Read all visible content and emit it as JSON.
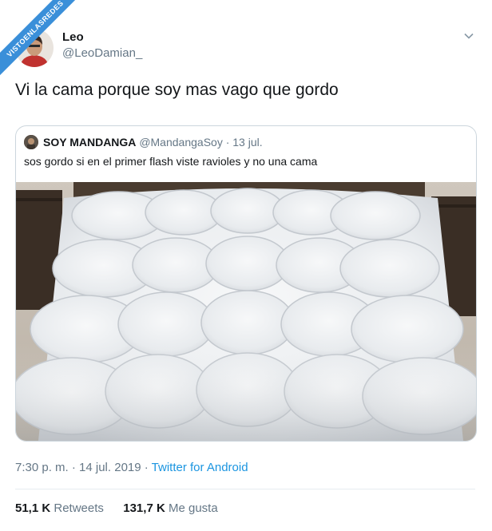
{
  "watermark": {
    "text": "VISTOENLASREDES"
  },
  "tweet": {
    "author_name": "Leo",
    "author_handle": "@LeoDamian_",
    "text": "Vi la cama porque soy mas vago que gordo",
    "timestamp": "7:30 p. m. · 14 jul. 2019",
    "separator": " · ",
    "source": "Twitter for Android",
    "menu_icon": "chevron-down-icon"
  },
  "quoted": {
    "author_name": "SOY MANDANGA",
    "author_handle": "@MandangaSoy",
    "date": "· 13 jul.",
    "text": "sos gordo si en el primer flash viste ravioles y no una cama",
    "image_description_icon": "bed-photo"
  },
  "stats": {
    "retweets_count": "51,1 K",
    "retweets_label": "Retweets",
    "likes_count": "131,7 K",
    "likes_label": "Me gusta"
  },
  "colors": {
    "text": "#14171a",
    "secondary": "#657786",
    "link": "#1b95e0",
    "border": "#ccd6dd",
    "banner": "#3a8fd9"
  }
}
